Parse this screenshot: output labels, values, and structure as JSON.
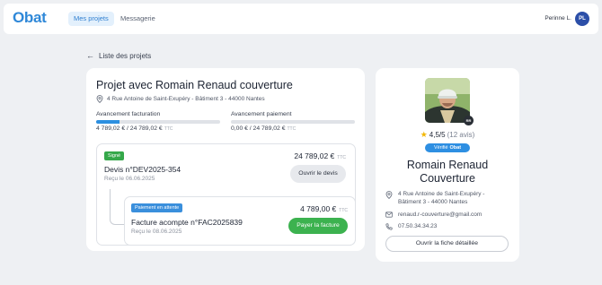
{
  "header": {
    "logo": "Obat",
    "nav": [
      {
        "label": "Mes projets",
        "active": true
      },
      {
        "label": "Messagerie",
        "active": false
      }
    ],
    "user_name": "Perinne L.",
    "user_initials": "PL"
  },
  "back_link": "Liste des projets",
  "project": {
    "title": "Projet avec Romain Renaud couverture",
    "address": "4 Rue Antoine de Saint-Exupéry - Bâtiment 3 - 44000 Nantes",
    "billing": {
      "label": "Avancement facturation",
      "amount": "4 789,02 € / 24 789,02 €",
      "ttc": "TTC",
      "progress": 0.19
    },
    "payment": {
      "label": "Avancement paiement",
      "amount": "0,00 € / 24 789,02 €",
      "ttc": "TTC",
      "progress": 0.0
    },
    "devis": {
      "badge": "Signé",
      "title": "Devis n°DEV2025-354",
      "date": "Reçu le 06.06.2025",
      "amount": "24 789,02 €",
      "ttc": "TTC",
      "button": "Ouvrir le devis"
    },
    "invoice": {
      "badge": "Paiement en attente",
      "title": "Facture acompte n°FAC2025839",
      "date": "Reçu le 08.06.2025",
      "amount": "4 789,00 €",
      "ttc": "TTC",
      "button": "Payer la facture"
    }
  },
  "artisan": {
    "badge_initials": "RR",
    "rating": "4,5/5",
    "reviews": "(12 avis)",
    "verified_prefix": "Vérifié",
    "verified_brand": "Obat",
    "name_line1": "Romain Renaud",
    "name_line2": "Couverture",
    "address": "4 Rue Antoine de Saint-Exupéry - Bâtiment 3 - 44000 Nantes",
    "email": "renaud.r-couverture@gmail.com",
    "phone": "07.50.34.34.23",
    "button": "Ouvrir la fiche détaillée"
  },
  "colors": {
    "brand": "#2f88d8",
    "success": "#3cb24f",
    "info": "#3a8fdc",
    "star": "#f2b705"
  }
}
